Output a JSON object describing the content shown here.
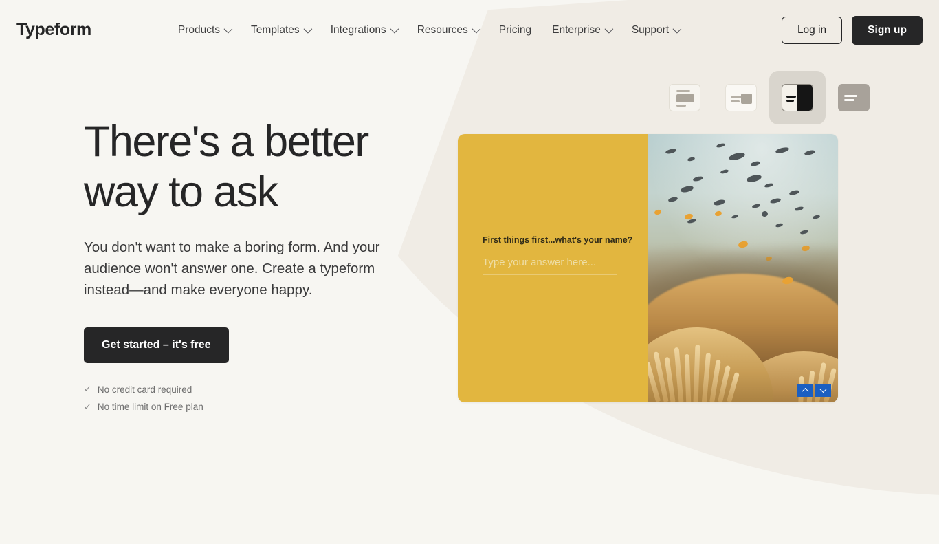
{
  "header": {
    "logo": "Typeform",
    "nav": [
      {
        "label": "Products",
        "has_caret": true,
        "icon": "chevron-down-icon"
      },
      {
        "label": "Templates",
        "has_caret": true,
        "icon": "chevron-down-icon"
      },
      {
        "label": "Integrations",
        "has_caret": true,
        "icon": "chevron-down-icon"
      },
      {
        "label": "Resources",
        "has_caret": true,
        "icon": "chevron-down-icon"
      },
      {
        "label": "Pricing",
        "has_caret": false,
        "icon": ""
      },
      {
        "label": "Enterprise",
        "has_caret": true,
        "icon": "chevron-down-icon"
      },
      {
        "label": "Support",
        "has_caret": true,
        "icon": "chevron-down-icon"
      }
    ],
    "login_label": "Log in",
    "signup_label": "Sign up"
  },
  "hero": {
    "headline": "There's a better way to ask",
    "subhead": "You don't want to make a boring form. And your audience won't answer one. Create a typeform instead—and make everyone happy.",
    "cta_label": "Get started – it's free",
    "perks": [
      {
        "tick": "✓",
        "label": "No credit card required"
      },
      {
        "tick": "✓",
        "label": "No time limit on Free plan"
      }
    ]
  },
  "layout_switcher": {
    "options": [
      {
        "name": "layout-stacked-center-icon",
        "active": false
      },
      {
        "name": "layout-text-left-image-right-icon",
        "active": false
      },
      {
        "name": "layout-split-half-icon",
        "active": true
      },
      {
        "name": "layout-full-background-icon",
        "active": false
      }
    ]
  },
  "preview": {
    "question": "First things first...what's your name?",
    "answer_placeholder": "Type your answer here...",
    "panel_color": "#e2b63f",
    "image_alt": "underwater-coral-reef-with-fish",
    "nav_up": "⌃",
    "nav_down": "⌄",
    "nav_color": "#1b5fc1"
  },
  "theme": {
    "page_bg": "#f7f6f2",
    "page_bg_alt": "#f0ece5",
    "ink": "#262627",
    "accent_yellow": "#e2b63f"
  }
}
